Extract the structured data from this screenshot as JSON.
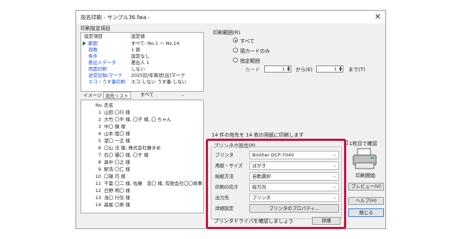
{
  "window": {
    "title": "宛名印刷 - サンプル36.fwa -",
    "close_glyph": "✕"
  },
  "settings": {
    "group_label": "印刷設定項目",
    "col_item": "設定項目",
    "col_value": "設定値",
    "rows": [
      {
        "item": "範囲",
        "value": "すべて: No.1 ～ No.14"
      },
      {
        "item": "部数",
        "value": "1 部"
      },
      {
        "item": "条件",
        "value": "設定なし"
      },
      {
        "item": "差出人データ",
        "value": "差出人 1"
      },
      {
        "item": "両面印刷",
        "value": "しない"
      },
      {
        "item": "送受記録/マーク",
        "value": "2025記/年賀状[出]マーク"
      },
      {
        "item": "エコ・うす墨印刷",
        "value": "エコ:しない うす墨:しない"
      }
    ]
  },
  "tabs": {
    "image": "イメージ",
    "list": "宛先リスト",
    "filter_value": "すべて"
  },
  "addr_list": {
    "col_no": "No.",
    "col_name": "氏名",
    "rows": [
      {
        "no": "1",
        "name": "山田 〇行 様"
      },
      {
        "no": "2",
        "name": "大竹 〇平 様, 〇子 様, 〇 ちゃん"
      },
      {
        "no": "3",
        "name": "中〇 鏡 様"
      },
      {
        "no": "4",
        "name": "山本 陸〇 様"
      },
      {
        "no": "5",
        "name": "望〇 一正 様"
      },
      {
        "no": "6",
        "name": "〇山 法 様, 株式会社藤まめ"
      },
      {
        "no": "7",
        "name": "石〇 優〇 様, 〇子 様"
      },
      {
        "no": "8",
        "name": "具中 〇之 様"
      },
      {
        "no": "9",
        "name": "駅浩 〇仁 様"
      },
      {
        "no": "10",
        "name": "〇雄 巧 様"
      },
      {
        "no": "11",
        "name": "千葉 〇二 様, 佐藤　忠〇 様, 有限会社〇〇商事"
      },
      {
        "no": "12",
        "name": "日野 明〇 様"
      },
      {
        "no": "13",
        "name": "浅〇 行信 様"
      },
      {
        "no": "14",
        "name": "森尾 〇男 様"
      }
    ]
  },
  "range": {
    "group_label": "印刷範囲(R)",
    "opt_all": "すべて",
    "opt_current": "現カードのみ",
    "opt_specify": "指定範囲",
    "card_label": "カード",
    "from_value": "1",
    "from_label": "から(E)",
    "to_value": "1",
    "to_label": "まで(T)"
  },
  "summary": "14 件の宛先を 14 枚の用紙に印刷します",
  "printer_settings": {
    "group_label": "プリンタの設定(P)",
    "rows": [
      {
        "label": "プリンタ",
        "value": "Brother DCP-7040"
      },
      {
        "label": "用紙・サイズ",
        "value": "はがき"
      },
      {
        "label": "給紙方法",
        "value": "自動選択"
      },
      {
        "label": "印刷の向き",
        "value": "縦方向"
      },
      {
        "label": "出力先",
        "value": "プリンタ"
      }
    ],
    "detail_label": "詳細設定",
    "property_button": "プリンタのプロパティ...",
    "driver_note": "プリンタドライバを確認しましょう",
    "detail_button": "詳細"
  },
  "right": {
    "confirm_checkbox": "1枚目で確認",
    "print_start": "印刷開始",
    "preview": "プレビュー(V)",
    "help": "ヘルプ(H)",
    "close": "閉じる"
  },
  "icons": [
    "close-icon",
    "play-arrow-icon",
    "printer-icon",
    "dropdown-icon",
    "spin-icon"
  ]
}
